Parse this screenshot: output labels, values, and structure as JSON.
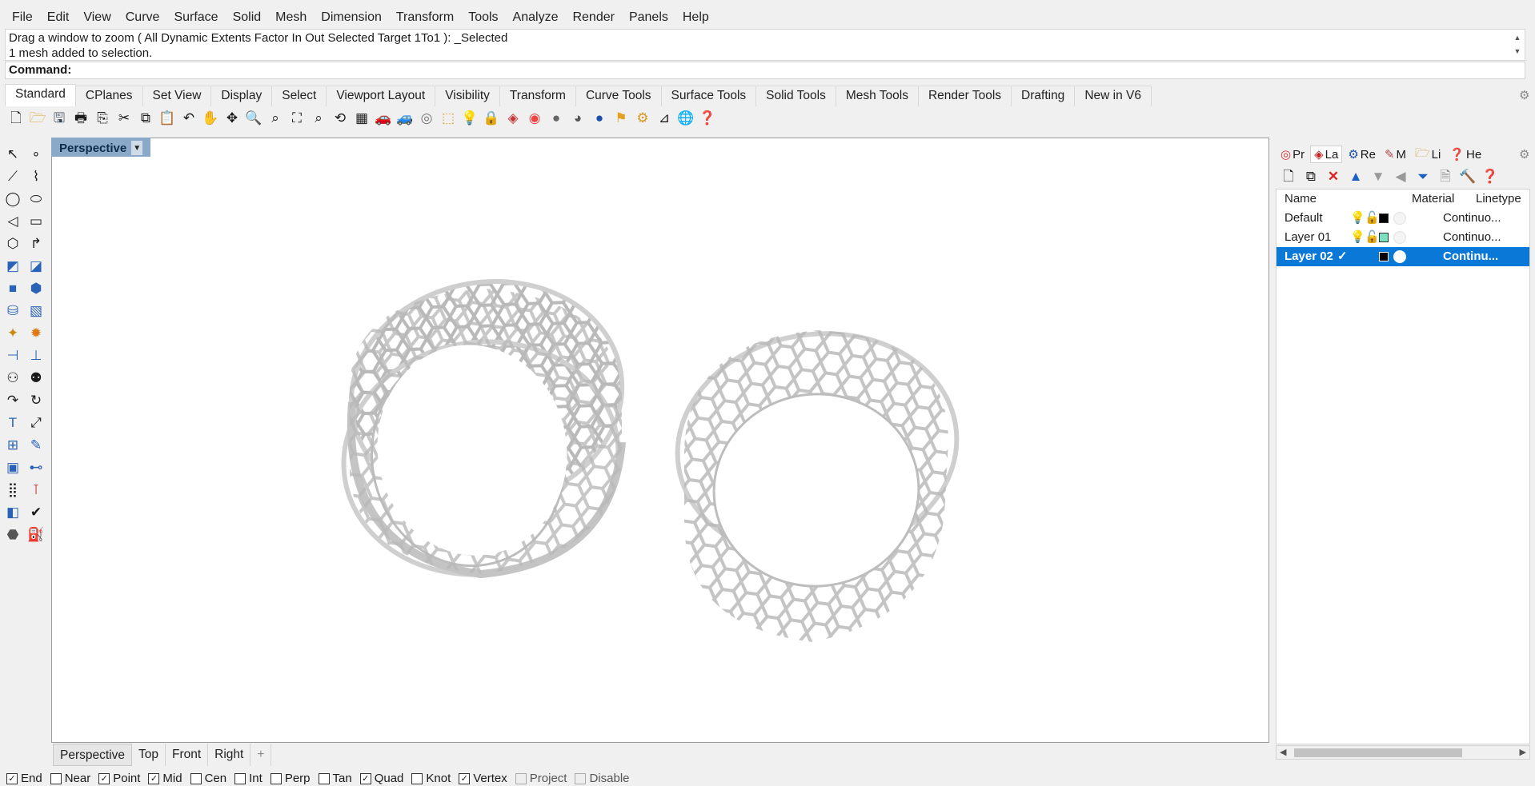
{
  "menu": [
    "File",
    "Edit",
    "View",
    "Curve",
    "Surface",
    "Solid",
    "Mesh",
    "Dimension",
    "Transform",
    "Tools",
    "Analyze",
    "Render",
    "Panels",
    "Help"
  ],
  "history": {
    "line1": "Drag a window to zoom ( All  Dynamic  Extents  Factor  In  Out  Selected  Target  1To1 ): _Selected",
    "line2": "1 mesh added to selection."
  },
  "command": {
    "label": "Command:"
  },
  "tabs": [
    "Standard",
    "CPlanes",
    "Set View",
    "Display",
    "Select",
    "Viewport Layout",
    "Visibility",
    "Transform",
    "Curve Tools",
    "Surface Tools",
    "Solid Tools",
    "Mesh Tools",
    "Render Tools",
    "Drafting",
    "New in V6"
  ],
  "viewport": {
    "label": "Perspective",
    "tabs": [
      "Perspective",
      "Top",
      "Front",
      "Right"
    ],
    "add_tab": "+"
  },
  "osnap": [
    {
      "label": "End",
      "checked": true
    },
    {
      "label": "Near",
      "checked": false
    },
    {
      "label": "Point",
      "checked": true
    },
    {
      "label": "Mid",
      "checked": true
    },
    {
      "label": "Cen",
      "checked": false
    },
    {
      "label": "Int",
      "checked": false
    },
    {
      "label": "Perp",
      "checked": false
    },
    {
      "label": "Tan",
      "checked": false
    },
    {
      "label": "Quad",
      "checked": true
    },
    {
      "label": "Knot",
      "checked": false
    },
    {
      "label": "Vertex",
      "checked": true
    },
    {
      "label": "Project",
      "checked": false,
      "disabled": true
    },
    {
      "label": "Disable",
      "checked": false,
      "disabled": true
    }
  ],
  "panel": {
    "tabs": [
      "Pr",
      "La",
      "Re",
      "M",
      "Li",
      "He"
    ],
    "columns": {
      "name": "Name",
      "material": "Material",
      "linetype": "Linetype"
    },
    "layers": [
      {
        "name": "Default",
        "linetype": "Continuo...",
        "color": "#000000",
        "current": false,
        "selected": false
      },
      {
        "name": "Layer 01",
        "linetype": "Continuo...",
        "color": "#7be0c0",
        "current": false,
        "selected": false
      },
      {
        "name": "Layer 02",
        "linetype": "Continu...",
        "color": "#000000",
        "current": true,
        "selected": true
      }
    ]
  },
  "colors": {
    "accent": "#0a78d7",
    "viewport_label": "#8aa9c8",
    "selection": "#0a78d7"
  }
}
